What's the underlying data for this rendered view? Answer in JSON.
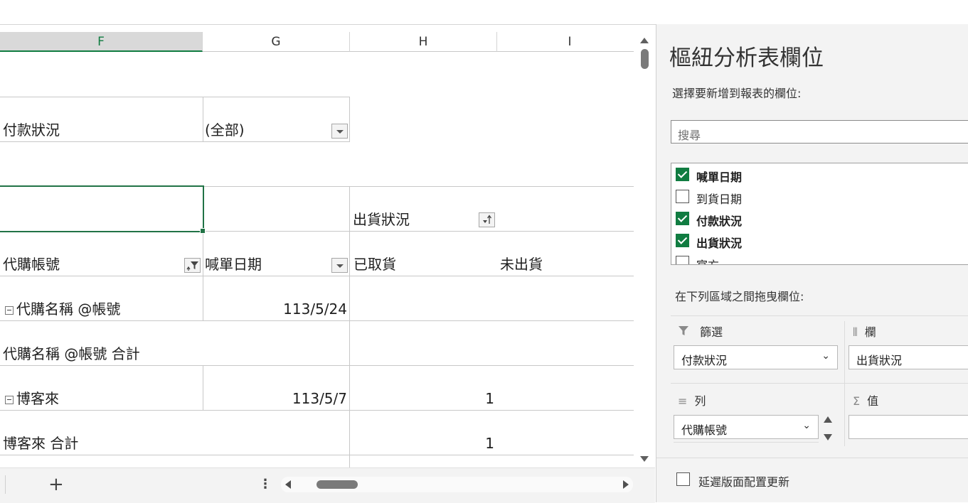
{
  "columns": [
    "F",
    "G",
    "H",
    "I"
  ],
  "sheet": {
    "filter_label": "付款狀況",
    "filter_value": "(全部)",
    "column_field_label": "出貨狀況",
    "row_field_label": "代購帳號",
    "date_field_label": "喊單日期",
    "col_values": [
      "已取貨",
      "未出貨"
    ],
    "rows": [
      {
        "label": "代購名稱 @帳號",
        "date": "113/5/24",
        "h": "",
        "collapsible": true
      },
      {
        "label": "代購名稱 @帳號 合計",
        "date": "",
        "h": "",
        "collapsible": false
      },
      {
        "label": "博客來",
        "date": "113/5/7",
        "h": "1",
        "collapsible": true
      },
      {
        "label": "博客來 合計",
        "date": "",
        "h": "1",
        "collapsible": false
      }
    ]
  },
  "sheetbar": {
    "add": "+",
    "more": "⋮"
  },
  "pane": {
    "title": "樞紐分析表欄位",
    "subtitle": "選擇要新增到報表的欄位:",
    "search_placeholder": "搜尋",
    "fields": [
      {
        "label": "喊單日期",
        "checked": true
      },
      {
        "label": "到貨日期",
        "checked": false
      },
      {
        "label": "付款狀況",
        "checked": true
      },
      {
        "label": "出貨狀況",
        "checked": true
      },
      {
        "label": "官方",
        "checked": false
      }
    ],
    "drag_hint": "在下列區域之間拖曳欄位:",
    "areas": {
      "filters": {
        "label": "篩選",
        "value": "付款狀況"
      },
      "columns": {
        "label": "欄",
        "value": "出貨狀況"
      },
      "rows": {
        "label": "列",
        "value": "代購帳號"
      },
      "values": {
        "label": "值",
        "value": ""
      }
    },
    "defer_label": "延遲版面配置更新"
  }
}
